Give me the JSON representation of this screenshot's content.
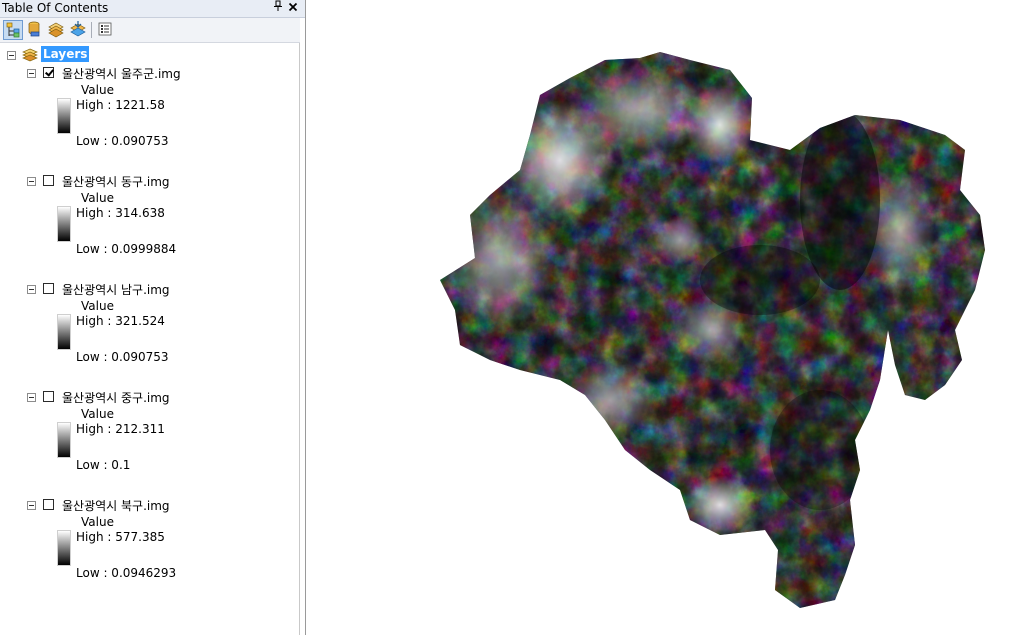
{
  "toc": {
    "title": "Table Of Contents",
    "pin_glyph": "ᵖ",
    "close_glyph": "✕",
    "toolbar": [
      {
        "name": "list-by-drawing-order-button",
        "icon": "drawing-order-icon",
        "active": true
      },
      {
        "name": "list-by-source-button",
        "icon": "source-icon",
        "active": false
      },
      {
        "name": "list-by-visibility-button",
        "icon": "visibility-icon",
        "active": false
      },
      {
        "name": "list-by-selection-button",
        "icon": "selection-icon",
        "active": false
      },
      {
        "name": "options-button",
        "icon": "options-icon",
        "active": false
      }
    ],
    "root_label": "Layers",
    "layers": [
      {
        "name": "울산광역시 울주군.img",
        "checked": true,
        "field": "Value",
        "high": "High : 1221.58",
        "low": "Low : 0.090753"
      },
      {
        "name": "울산광역시 동구.img",
        "checked": false,
        "field": "Value",
        "high": "High : 314.638",
        "low": "Low : 0.0999884"
      },
      {
        "name": "울산광역시 남구.img",
        "checked": false,
        "field": "Value",
        "high": "High : 321.524",
        "low": "Low : 0.090753"
      },
      {
        "name": "울산광역시 중구.img",
        "checked": false,
        "field": "Value",
        "high": "High : 212.311",
        "low": "Low : 0.1"
      },
      {
        "name": "울산광역시 북구.img",
        "checked": false,
        "field": "Value",
        "high": "High : 577.385",
        "low": "Low : 0.0946293"
      }
    ]
  },
  "colors": {
    "selection": "#3399ff",
    "ramp_high": "#ffffff",
    "ramp_low": "#000000"
  },
  "map": {
    "icon": "elevation-raster-image"
  }
}
